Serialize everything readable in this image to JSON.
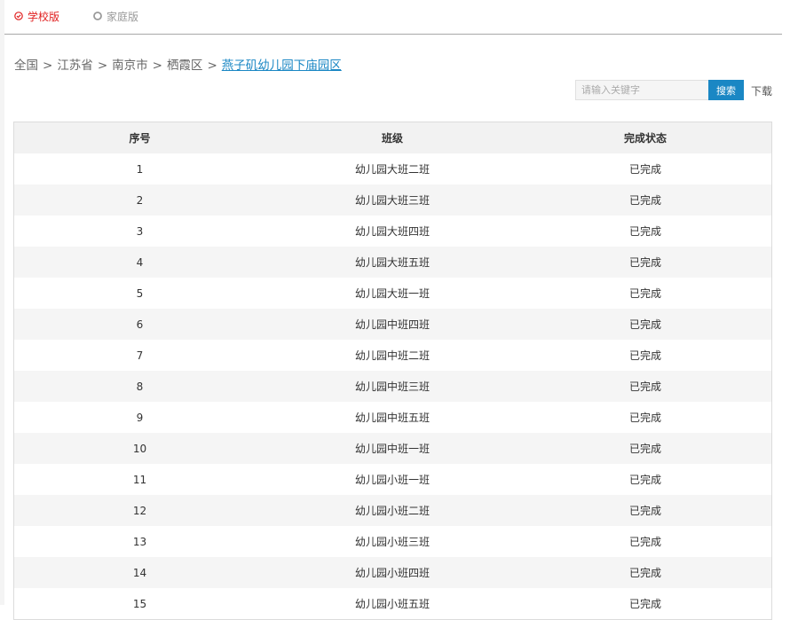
{
  "tabs": {
    "school_label": "学校版",
    "family_label": "家庭版",
    "active_color": "#e02020",
    "inactive_color": "#9a9a9a"
  },
  "breadcrumb": {
    "items": [
      "全国",
      "江苏省",
      "南京市",
      "栖霞区"
    ],
    "separator": ">",
    "current": "燕子矶幼儿园下庙园区"
  },
  "search": {
    "placeholder": "请输入关键字",
    "value": "",
    "button_label": "搜索",
    "download_label": "下载",
    "accent_color": "#1a87c4"
  },
  "table": {
    "headers": [
      "序号",
      "班级",
      "完成状态"
    ],
    "rows": [
      [
        "1",
        "幼儿园大班二班",
        "已完成"
      ],
      [
        "2",
        "幼儿园大班三班",
        "已完成"
      ],
      [
        "3",
        "幼儿园大班四班",
        "已完成"
      ],
      [
        "4",
        "幼儿园大班五班",
        "已完成"
      ],
      [
        "5",
        "幼儿园大班一班",
        "已完成"
      ],
      [
        "6",
        "幼儿园中班四班",
        "已完成"
      ],
      [
        "7",
        "幼儿园中班二班",
        "已完成"
      ],
      [
        "8",
        "幼儿园中班三班",
        "已完成"
      ],
      [
        "9",
        "幼儿园中班五班",
        "已完成"
      ],
      [
        "10",
        "幼儿园中班一班",
        "已完成"
      ],
      [
        "11",
        "幼儿园小班一班",
        "已完成"
      ],
      [
        "12",
        "幼儿园小班二班",
        "已完成"
      ],
      [
        "13",
        "幼儿园小班三班",
        "已完成"
      ],
      [
        "14",
        "幼儿园小班四班",
        "已完成"
      ],
      [
        "15",
        "幼儿园小班五班",
        "已完成"
      ]
    ]
  }
}
